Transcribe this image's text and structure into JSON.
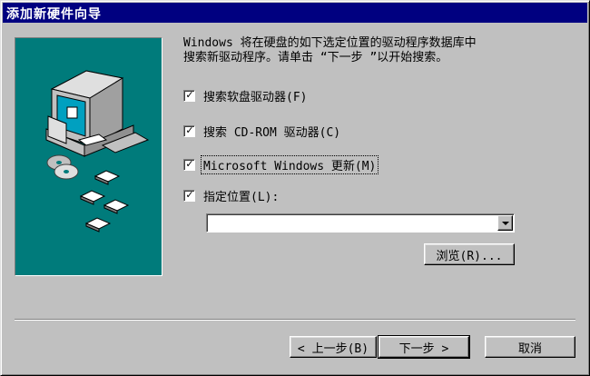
{
  "window": {
    "title": "添加新硬件向导"
  },
  "intro": {
    "text": "Windows 将在硬盘的如下选定位置的驱动程序数据库中\n搜索新驱动程序。请单击 “下一步 ”以开始搜索。"
  },
  "options": [
    {
      "label": "搜索软盘驱动器(F)",
      "checked": true
    },
    {
      "label": "搜索 CD-ROM 驱动器(C)",
      "checked": true
    },
    {
      "label": "Microsoft Windows 更新(M)",
      "checked": true,
      "focused": true
    },
    {
      "label": "指定位置(L):",
      "checked": true
    }
  ],
  "location": {
    "value": ""
  },
  "buttons": {
    "browse": "浏览(R)...",
    "back": "< 上一步(B)",
    "next": "下一步 >",
    "cancel": "取消"
  },
  "colors": {
    "titlebar": "#000080",
    "face": "#c0c0c0",
    "illustration_bg": "#007b7b"
  },
  "icons": {
    "check": "✓"
  }
}
